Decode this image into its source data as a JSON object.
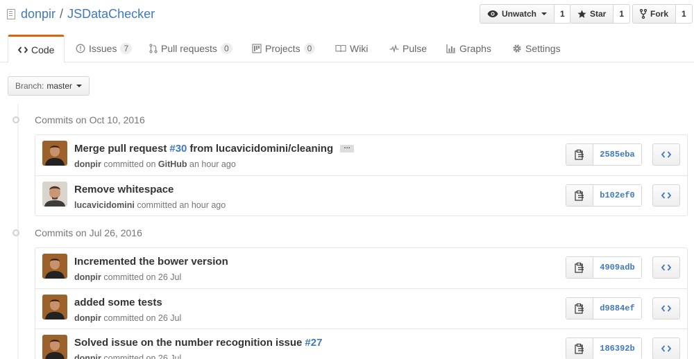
{
  "repo": {
    "owner": "donpir",
    "separator": "/",
    "name": "JSDataChecker"
  },
  "actions": {
    "watch": {
      "label": "Unwatch",
      "count": "1"
    },
    "star": {
      "label": "Star",
      "count": "1"
    },
    "fork": {
      "label": "Fork",
      "count": "1"
    }
  },
  "tabs": [
    {
      "label": "Code",
      "icon": "code-icon"
    },
    {
      "label": "Issues",
      "count": "7",
      "icon": "issue-icon"
    },
    {
      "label": "Pull requests",
      "count": "0",
      "icon": "pull-request-icon"
    },
    {
      "label": "Projects",
      "count": "0",
      "icon": "project-icon"
    },
    {
      "label": "Wiki",
      "icon": "book-icon"
    },
    {
      "label": "Pulse",
      "icon": "pulse-icon"
    },
    {
      "label": "Graphs",
      "icon": "graph-icon"
    },
    {
      "label": "Settings",
      "icon": "gear-icon"
    }
  ],
  "branch": {
    "label": "Branch:",
    "value": "master"
  },
  "groups": [
    {
      "title": "Commits on Oct 10, 2016",
      "commits": [
        {
          "message_pre": "Merge pull request",
          "message_link": "#30",
          "message_post": "from lucavicidomini/cleaning",
          "has_ellipsis": true,
          "author": "donpir",
          "action": "committed on",
          "via": "GitHub",
          "time": "an hour ago",
          "sha": "2585eba"
        },
        {
          "message_pre": "Remove whitespace",
          "author": "lucavicidomini",
          "action": "committed",
          "time": "an hour ago",
          "sha": "b102ef0"
        }
      ]
    },
    {
      "title": "Commits on Jul 26, 2016",
      "commits": [
        {
          "message_pre": "Incremented the bower version",
          "author": "donpir",
          "action": "committed on",
          "time": "26 Jul",
          "sha": "4909adb"
        },
        {
          "message_pre": "added some tests",
          "author": "donpir",
          "action": "committed on",
          "time": "26 Jul",
          "sha": "d9884ef"
        },
        {
          "message_pre": "Solved issue on the number recognition issue",
          "message_link": "#27",
          "author": "donpir",
          "action": "committed on",
          "time": "26 Jul",
          "sha": "186392b"
        }
      ]
    }
  ],
  "colors": {
    "link": "#4078c0",
    "tab_accent": "#d26911",
    "muted": "#767676"
  }
}
